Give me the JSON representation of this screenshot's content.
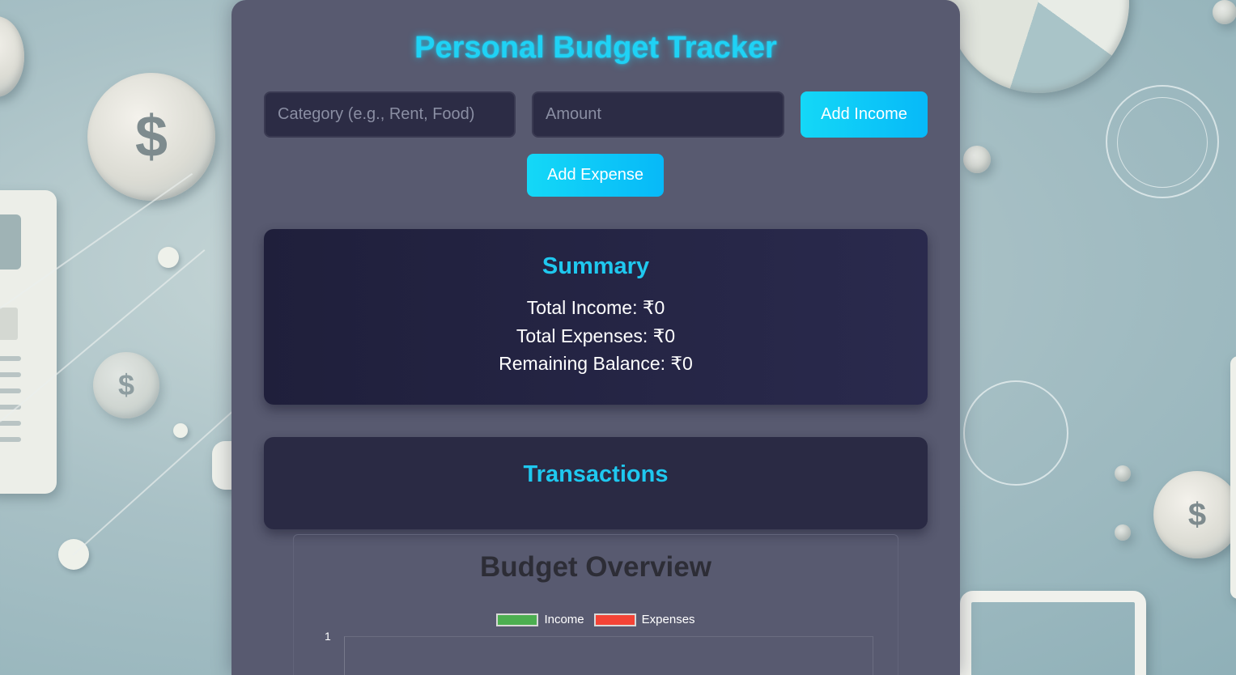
{
  "app": {
    "title": "Personal Budget Tracker"
  },
  "form": {
    "category": {
      "value": "",
      "placeholder": "Category (e.g., Rent, Food)"
    },
    "amount": {
      "value": "",
      "placeholder": "Amount"
    },
    "add_income_label": "Add Income",
    "add_expense_label": "Add Expense"
  },
  "summary": {
    "title": "Summary",
    "total_income": "Total Income: ₹0",
    "total_expenses": "Total Expenses: ₹0",
    "remaining_balance": "Remaining Balance: ₹0"
  },
  "transactions": {
    "title": "Transactions",
    "items": []
  },
  "chart_data": {
    "type": "bar",
    "title": "Budget Overview",
    "categories": [],
    "series": [
      {
        "name": "Income",
        "values": [],
        "color": "#4caf50"
      },
      {
        "name": "Expenses",
        "values": [],
        "color": "#f44336"
      }
    ],
    "yticks": [
      "1"
    ],
    "legend": "top"
  },
  "colors": {
    "accent": "#1fd2f5",
    "panel": "#585a70",
    "card": "#2a2a44",
    "button": "#07b9f8"
  }
}
